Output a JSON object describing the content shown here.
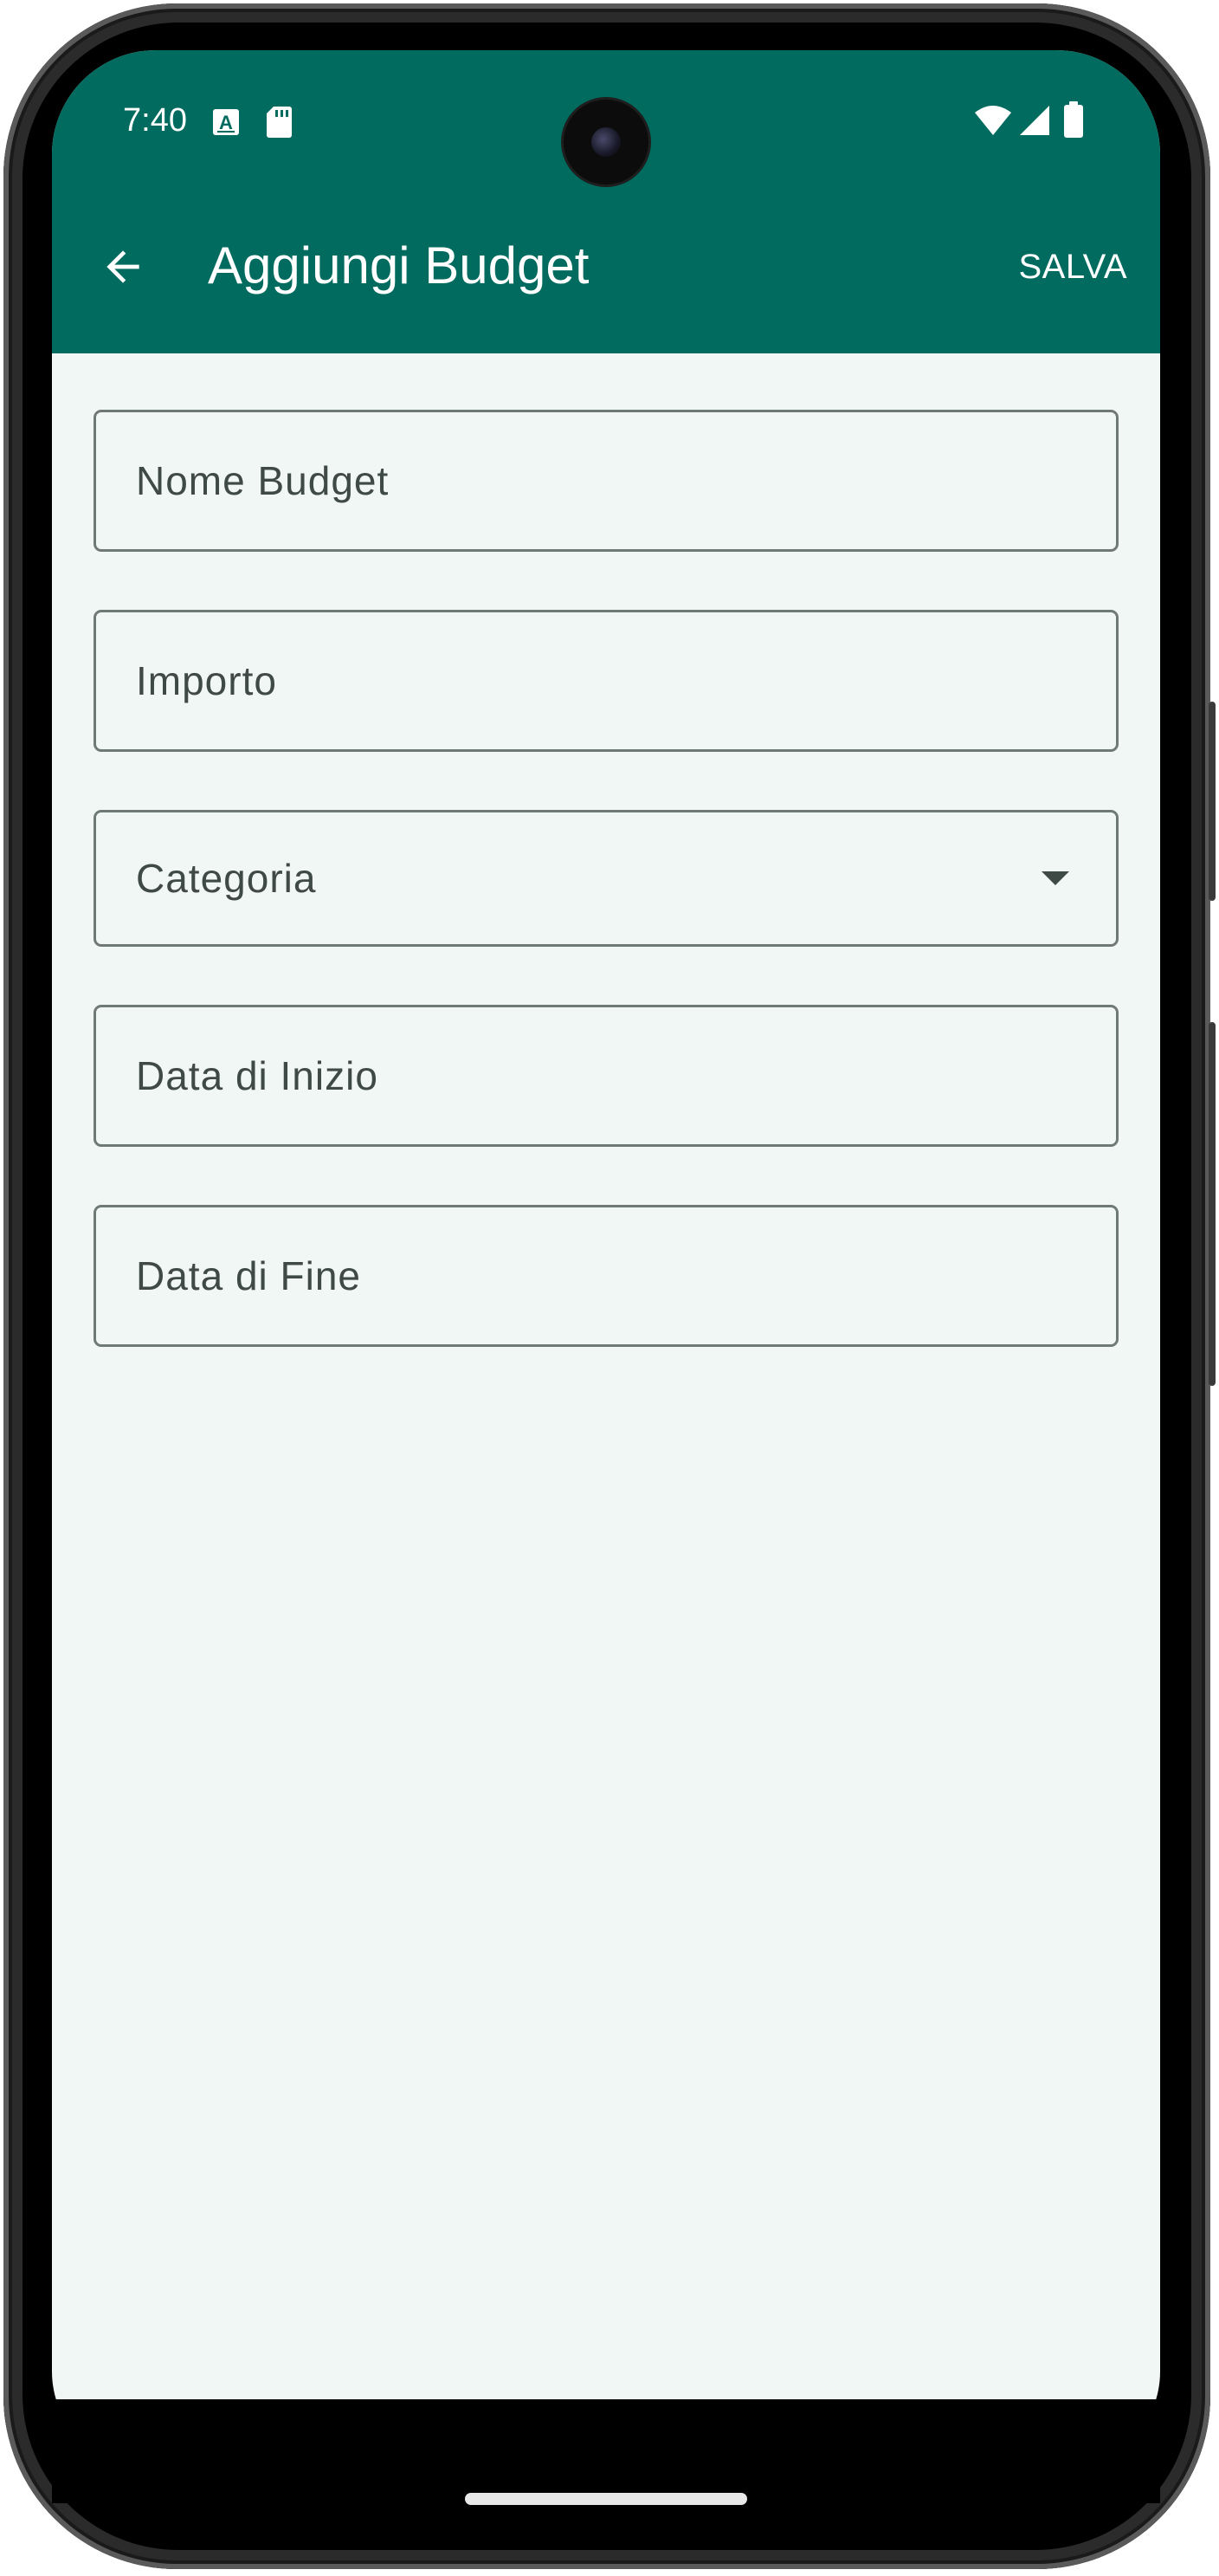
{
  "status_bar": {
    "time": "7:40",
    "icons_left": [
      "autofill-icon",
      "sd-card-icon"
    ],
    "icons_right": [
      "wifi-icon",
      "cellular-signal-icon",
      "battery-icon"
    ]
  },
  "app_bar": {
    "title": "Aggiungi Budget",
    "back_icon": "arrow-back-icon",
    "save_label": "SALVA"
  },
  "form": {
    "fields": [
      {
        "placeholder": "Nome Budget",
        "type": "text"
      },
      {
        "placeholder": "Importo",
        "type": "number"
      },
      {
        "placeholder": "Categoria",
        "type": "dropdown"
      },
      {
        "placeholder": "Data di Inizio",
        "type": "date"
      },
      {
        "placeholder": "Data di Fine",
        "type": "date"
      }
    ]
  },
  "colors": {
    "primary": "#006b5e",
    "background": "#f1f7f5",
    "outline": "#6f7976",
    "on_surface_variant": "#3f4946",
    "on_primary": "#ffffff"
  }
}
